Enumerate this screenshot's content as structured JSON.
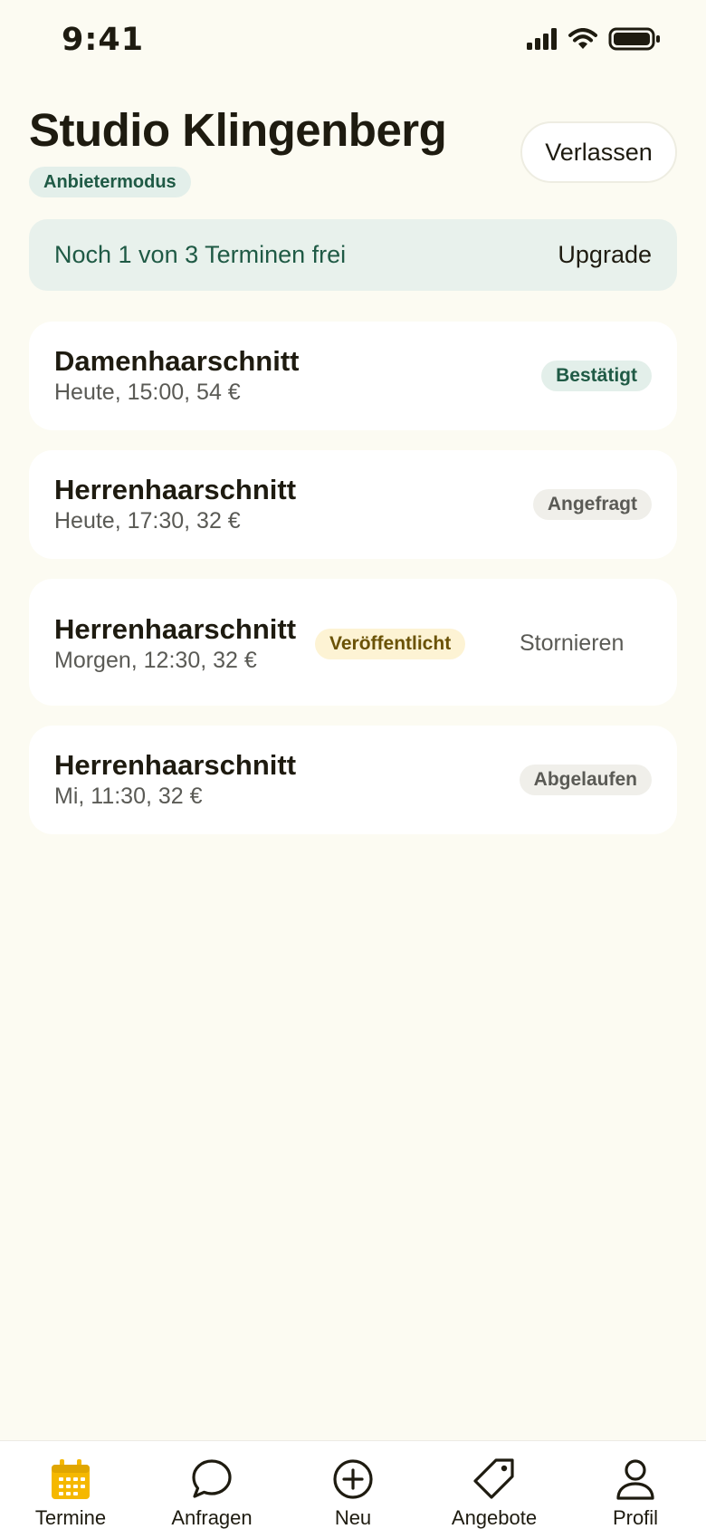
{
  "status_bar": {
    "time": "9:41"
  },
  "header": {
    "title": "Studio Klingenberg",
    "mode_badge": "Anbietermodus",
    "leave_label": "Verlassen"
  },
  "banner": {
    "text": "Noch 1 von 3 Terminen frei",
    "action_label": "Upgrade"
  },
  "appointments": [
    {
      "title": "Damenhaarschnitt",
      "details": "Heute, 15:00, 54 €",
      "status": "Bestätigt"
    },
    {
      "title": "Herrenhaarschnitt",
      "details": "Heute, 17:30, 32 €",
      "status": "Angefragt"
    },
    {
      "title": "Herrenhaarschnitt",
      "details": "Morgen, 12:30, 32 €",
      "status": "Veröffentlicht",
      "action_label": "Stornieren"
    },
    {
      "title": "Herrenhaarschnitt",
      "details": "Mi, 11:30, 32 €",
      "status": "Abgelaufen"
    }
  ],
  "tab_bar": {
    "active": "Termine",
    "accent_color": "#F5B800",
    "tabs": [
      {
        "label": "Termine",
        "icon": "calendar-icon"
      },
      {
        "label": "Anfragen",
        "icon": "chat-bubble-icon"
      },
      {
        "label": "Neu",
        "icon": "plus-circle-icon"
      },
      {
        "label": "Angebote",
        "icon": "tag-icon"
      },
      {
        "label": "Profil",
        "icon": "person-icon"
      }
    ]
  },
  "colors": {
    "background": "#FCFBF2",
    "primary_green": "#1F5A45",
    "banner_bg": "#E8F1EC",
    "published_bg": "#FDF3D4"
  }
}
